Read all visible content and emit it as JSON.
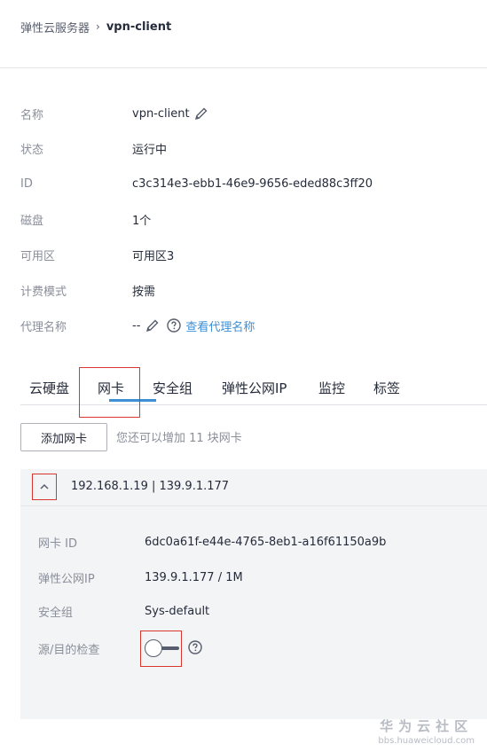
{
  "breadcrumb": {
    "parent": "弹性云服务器",
    "separator": "›",
    "current": "vpn-client"
  },
  "info": {
    "name_label": "名称",
    "name_value": "vpn-client",
    "status_label": "状态",
    "status_value": "运行中",
    "id_label": "ID",
    "id_value": "c3c314e3-ebb1-46e9-9656-eded88c3ff20",
    "disk_label": "磁盘",
    "disk_value": "1个",
    "az_label": "可用区",
    "az_value": "可用区3",
    "billing_label": "计费模式",
    "billing_value": "按需",
    "proxy_label": "代理名称",
    "proxy_value": "--",
    "proxy_link": "查看代理名称"
  },
  "tabs": [
    {
      "label": "云硬盘"
    },
    {
      "label": "网卡"
    },
    {
      "label": "安全组"
    },
    {
      "label": "弹性公网IP"
    },
    {
      "label": "监控"
    },
    {
      "label": "标签"
    }
  ],
  "active_tab": "网卡",
  "nic_toolbar": {
    "add_button": "添加网卡",
    "hint": "您还可以增加 11 块网卡"
  },
  "nic": {
    "title": "192.168.1.19 | 139.9.1.177",
    "id_label": "网卡 ID",
    "id_value": "6dc0a61f-e44e-4765-8eb1-a16f61150a9b",
    "eip_label": "弹性公网IP",
    "eip_value": "139.9.1.177 / 1M",
    "sg_label": "安全组",
    "sg_value": "Sys-default",
    "check_label": "源/目的检查",
    "check_enabled": false
  },
  "watermark": {
    "title": "华为云社区",
    "url": "bbs.huaweicloud.com"
  },
  "colors": {
    "accent": "#3d8fd6",
    "highlight": "#d9362d",
    "label": "#8a8e99",
    "text": "#252b3a"
  },
  "icons": {
    "edit": "pencil-icon",
    "help": "question-circle-icon",
    "collapse": "chevron-up-icon"
  }
}
